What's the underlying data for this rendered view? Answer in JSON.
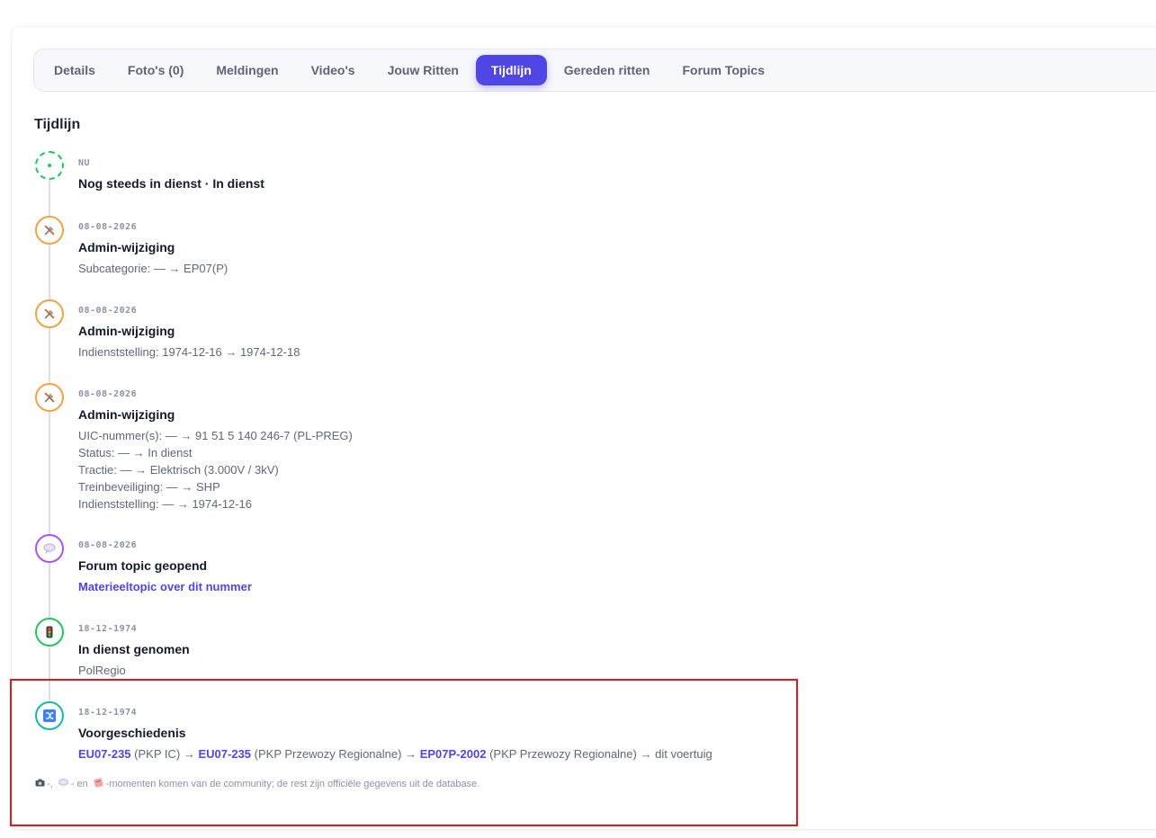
{
  "tabs": [
    {
      "label": "Details",
      "active": false
    },
    {
      "label": "Foto's (0)",
      "active": false
    },
    {
      "label": "Meldingen",
      "active": false
    },
    {
      "label": "Video's",
      "active": false
    },
    {
      "label": "Jouw Ritten",
      "active": false
    },
    {
      "label": "Tijdlijn",
      "active": true
    },
    {
      "label": "Gereden ritten",
      "active": false
    },
    {
      "label": "Forum Topics",
      "active": false
    }
  ],
  "section_title": "Tijdlijn",
  "events": [
    {
      "date": "NU",
      "title": "Nog steeds in dienst · In dienst",
      "icon": "now-dot-icon"
    },
    {
      "date": "08-08-2026",
      "title": "Admin-wijziging",
      "icon": "tools-icon",
      "details": [
        "Subcategorie: — → EP07(P)"
      ]
    },
    {
      "date": "08-08-2026",
      "title": "Admin-wijziging",
      "icon": "tools-icon",
      "details": [
        "Indienststelling: 1974-12-16 → 1974-12-18"
      ]
    },
    {
      "date": "08-08-2026",
      "title": "Admin-wijziging",
      "icon": "tools-icon",
      "details": [
        "UIC-nummer(s): — → 91 51 5 140 246-7 (PL-PREG)",
        "Status: — → In dienst",
        "Tractie: — → Elektrisch (3.000V / 3kV)",
        "Treinbeveiliging: — → SHP",
        "Indienststelling: — → 1974-12-16"
      ]
    },
    {
      "date": "08-08-2026",
      "title": "Forum topic geopend",
      "icon": "speech-bubble-icon",
      "link": "Materieeltopic over dit nummer"
    },
    {
      "date": "18-12-1974",
      "title": "In dienst genomen",
      "icon": "traffic-light-icon",
      "details": [
        "PolRegio"
      ]
    },
    {
      "date": "18-12-1974",
      "title": "Voorgeschiedenis",
      "icon": "shuffle-icon",
      "chain": {
        "n1": "EU07-235",
        "o1": "(PKP IC)",
        "arrow1": "→",
        "n2": "EU07-235",
        "o2": "(PKP Przewozy Regionalne)",
        "arrow2": "→",
        "n3": "EP07P-2002",
        "o3": "(PKP Przewozy Regionalne)",
        "tail": "→ dit voertuig"
      }
    }
  ],
  "footnote": {
    "sep1": "-,",
    "sep2": "- en",
    "text": "-momenten komen van de community; de rest zijn officiële gegevens uit de database.",
    "icons": [
      "camera-icon",
      "speech-bubble-icon",
      "ticket-icon"
    ]
  },
  "colors": {
    "accent": "#4f46e5",
    "now": "#22c55e",
    "admin": "#f0a347",
    "forum": "#a855f7",
    "service": "#22c55e",
    "history": "#14b8a6",
    "highlight": "#e01b1b"
  }
}
